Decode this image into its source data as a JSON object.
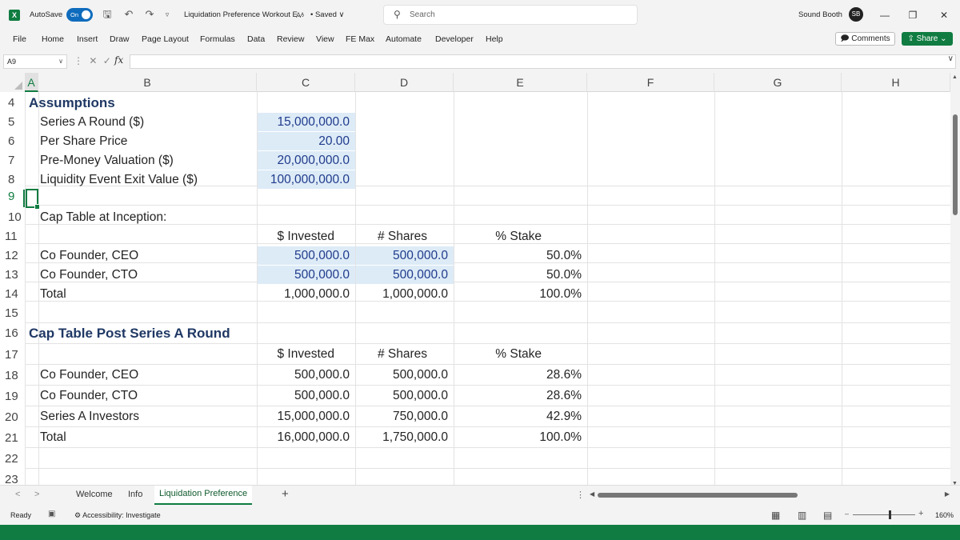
{
  "titlebar": {
    "app_badge": "X",
    "autosave_label": "AutoSave",
    "autosave_state": "On",
    "doc_title": "Liquidation Preference Workout E...",
    "saved_label": "• Saved ∨",
    "search_placeholder": "Search",
    "user_name": "Sound Booth",
    "user_initials": "SB"
  },
  "ribbon": {
    "tabs": [
      "File",
      "Home",
      "Insert",
      "Draw",
      "Page Layout",
      "Formulas",
      "Data",
      "Review",
      "View",
      "FE Max",
      "Automate",
      "Developer",
      "Help"
    ],
    "comments_label": "Comments",
    "share_label": "Share"
  },
  "formula_bar": {
    "name_box": "A9",
    "fx_label": "fx",
    "formula": ""
  },
  "grid": {
    "columns": [
      "A",
      "B",
      "C",
      "D",
      "E",
      "F",
      "G",
      "H"
    ],
    "rows": [
      "4",
      "5",
      "6",
      "7",
      "8",
      "9",
      "10",
      "11",
      "12",
      "13",
      "14",
      "15",
      "16",
      "17",
      "18",
      "19",
      "20",
      "21",
      "22",
      "23"
    ],
    "cells": {
      "A4": "Assumptions",
      "B5": "Series A Round ($)",
      "C5": "15,000,000.0",
      "B6": "Per Share Price",
      "C6": "20.00",
      "B7": "Pre-Money Valuation ($)",
      "C7": "20,000,000.0",
      "B8": "Liquidity Event Exit Value ($)",
      "C8": "100,000,000.0",
      "B10": "Cap Table at Inception:",
      "C11": "$ Invested",
      "D11": "# Shares",
      "E11": "% Stake",
      "B12": "Co Founder, CEO",
      "C12": "500,000.0",
      "D12": "500,000.0",
      "E12": "50.0%",
      "B13": "Co Founder, CTO",
      "C13": "500,000.0",
      "D13": "500,000.0",
      "E13": "50.0%",
      "B14": "Total",
      "C14": "1,000,000.0",
      "D14": "1,000,000.0",
      "E14": "100.0%",
      "A16": "Cap Table Post Series A Round",
      "C17": "$ Invested",
      "D17": "# Shares",
      "E17": "% Stake",
      "B18": "Co Founder, CEO",
      "C18": "500,000.0",
      "D18": "500,000.0",
      "E18": "28.6%",
      "B19": "Co Founder, CTO",
      "C19": "500,000.0",
      "D19": "500,000.0",
      "E19": "28.6%",
      "B20": "Series A Investors",
      "C20": "15,000,000.0",
      "D20": "750,000.0",
      "E20": "42.9%",
      "B21": "Total",
      "C21": "16,000,000.0",
      "D21": "1,750,000.0",
      "E21": "100.0%"
    }
  },
  "sheets": {
    "tabs": [
      "Welcome",
      "Info",
      "Liquidation Preference"
    ],
    "active": "Liquidation Preference",
    "add_label": "+"
  },
  "status": {
    "ready": "Ready",
    "accessibility": "Accessibility: Investigate",
    "zoom": "160%"
  },
  "colors": {
    "accent": "#107c41",
    "input_fill": "#ddebf7",
    "input_text": "#1f3b8c"
  }
}
